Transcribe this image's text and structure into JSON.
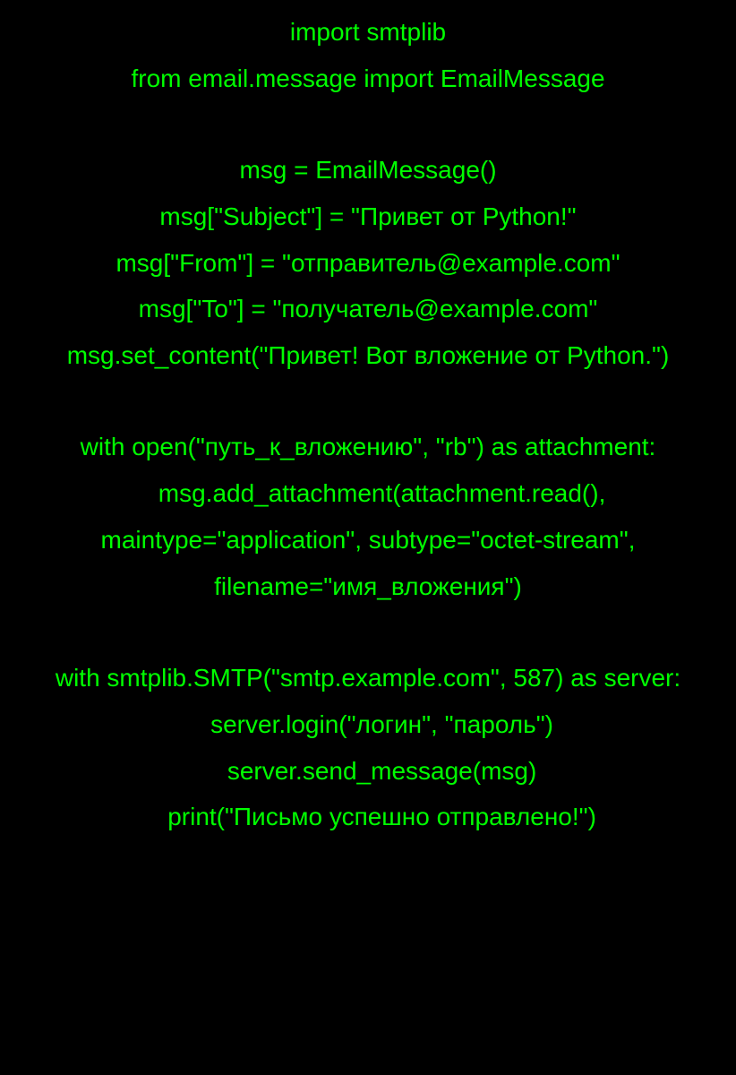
{
  "code": {
    "lines": [
      "import smtplib",
      "from email.message import EmailMessage",
      "",
      "msg = EmailMessage()",
      "msg[\"Subject\"] = \"Привет от Python!\"",
      "msg[\"From\"] = \"отправитель@example.com\"",
      "msg[\"To\"] = \"получатель@example.com\"",
      "msg.set_content(\"Привет! Вот вложение от Python.\")",
      "",
      "with open(\"путь_к_вложению\", \"rb\") as attachment:",
      "    msg.add_attachment(attachment.read(), maintype=\"application\", subtype=\"octet-stream\", filename=\"имя_вложения\")",
      "",
      "with smtplib.SMTP(\"smtp.example.com\", 587) as server:",
      "    server.login(\"логин\", \"пароль\")",
      "    server.send_message(msg)",
      "    print(\"Письмо успешно отправлено!\")"
    ]
  },
  "colors": {
    "background": "#000000",
    "text": "#00ff00"
  }
}
